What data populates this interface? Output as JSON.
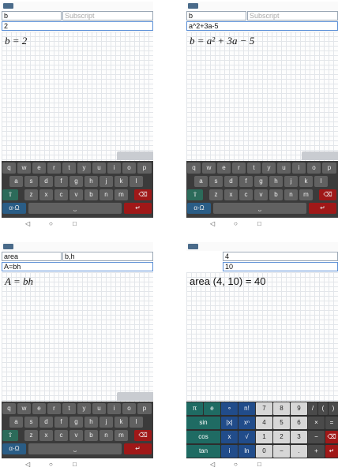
{
  "panels": [
    {
      "fields": {
        "name": "b",
        "subscript": "Subscript",
        "definition": "2"
      },
      "expression": "b = 2"
    },
    {
      "fields": {
        "name": "b",
        "subscript": "Subscript",
        "definition": "a^2+3a-5"
      },
      "expression": "b = a² + 3a − 5"
    },
    {
      "fields": {
        "name": "area",
        "subscript": "b,h",
        "definition": "A=bh"
      },
      "expression": "A = bh"
    },
    {
      "fields": {
        "arg1": "4",
        "arg2": "10"
      },
      "expression": "area (4, 10) = 40"
    }
  ],
  "keyboard": {
    "row1": [
      "q",
      "w",
      "e",
      "r",
      "t",
      "y",
      "u",
      "i",
      "o",
      "p"
    ],
    "row2": [
      "a",
      "s",
      "d",
      "f",
      "g",
      "h",
      "j",
      "k",
      "l"
    ],
    "row3": [
      "z",
      "x",
      "c",
      "v",
      "b",
      "n",
      "m"
    ],
    "shift_key": "⇧",
    "backspace_key": "⌫",
    "mode_key": "α-Ω",
    "space_key": "⎵",
    "enter_key": "↵",
    "keyboard_colors": {
      "mode": "#2a5d86",
      "enter": "#a01818",
      "shift": "#2c6b5a"
    }
  },
  "calculator": {
    "row1": [
      "π",
      "e",
      "∘",
      "n!",
      "7",
      "8",
      "9",
      "/",
      "(",
      ")"
    ],
    "row2": [
      "sin",
      "|x|",
      "xⁿ",
      "4",
      "5",
      "6",
      "×",
      "="
    ],
    "row3": [
      "cos",
      "x",
      "√",
      "1",
      "2",
      "3",
      "−",
      "⌫"
    ],
    "row4": [
      "tan",
      "i",
      "ln",
      "0",
      "−",
      ".",
      "+",
      "↵"
    ]
  },
  "navbar": [
    "◁",
    "○",
    "□"
  ]
}
